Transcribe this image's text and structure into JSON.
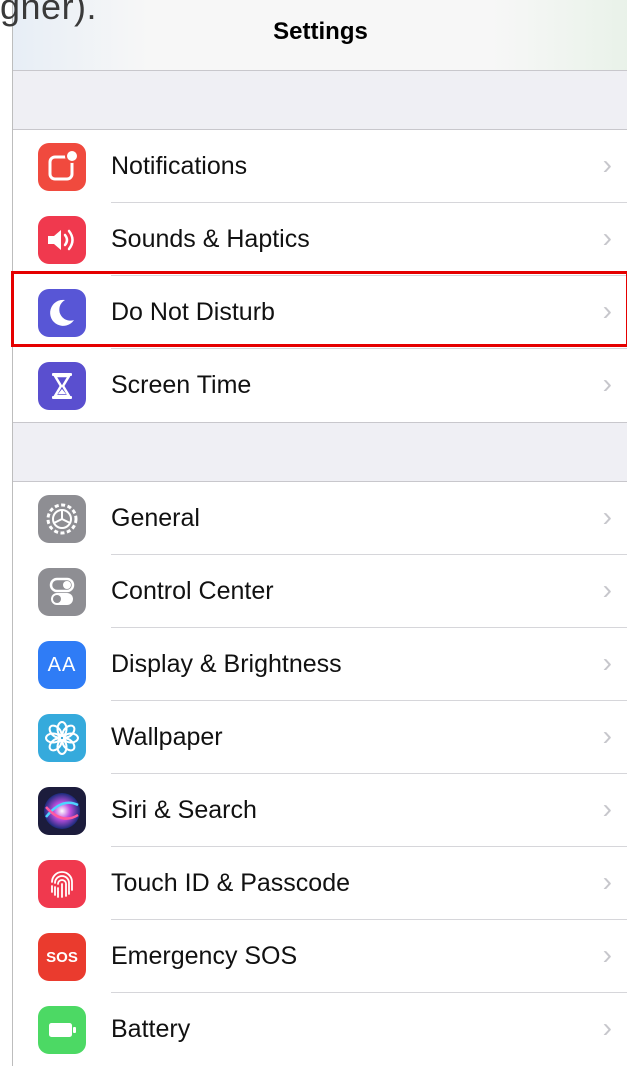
{
  "fragment_text": "gner).",
  "navbar": {
    "title": "Settings"
  },
  "chevron": "›",
  "group1": [
    {
      "label": "Notifications",
      "icon": "notifications-icon",
      "color": "#f04a3e"
    },
    {
      "label": "Sounds & Haptics",
      "icon": "sounds-icon",
      "color": "#f0394e"
    },
    {
      "label": "Do Not Disturb",
      "icon": "moon-icon",
      "color": "#5856d6"
    },
    {
      "label": "Screen Time",
      "icon": "hourglass-icon",
      "color": "#5a4fcf"
    }
  ],
  "group2": [
    {
      "label": "General",
      "icon": "gear-icon",
      "color": "#8e8e93"
    },
    {
      "label": "Control Center",
      "icon": "toggles-icon",
      "color": "#8e8e93"
    },
    {
      "label": "Display & Brightness",
      "icon": "display-icon",
      "color": "#2f7cf6",
      "icon_text": "AA"
    },
    {
      "label": "Wallpaper",
      "icon": "flower-icon",
      "color": "#35aadc"
    },
    {
      "label": "Siri & Search",
      "icon": "siri-icon",
      "color": "#1c1c3c"
    },
    {
      "label": "Touch ID & Passcode",
      "icon": "fingerprint-icon",
      "color": "#f0394e"
    },
    {
      "label": "Emergency SOS",
      "icon": "sos-icon",
      "color": "#ea3b2e",
      "icon_text": "SOS"
    },
    {
      "label": "Battery",
      "icon": "battery-icon",
      "color": "#4cd964"
    }
  ],
  "highlight_color": "#e50000"
}
